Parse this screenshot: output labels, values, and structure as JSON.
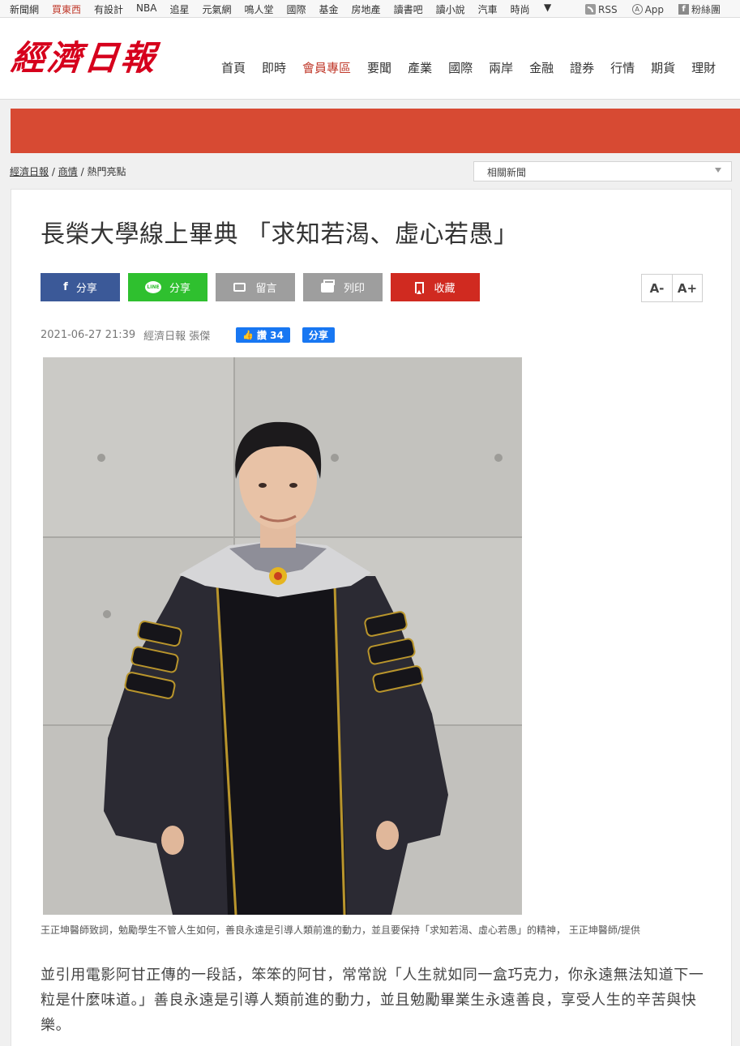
{
  "topbar": {
    "links": [
      "新聞網",
      "買東西",
      "有設計",
      "NBA",
      "追星",
      "元氣網",
      "鳴人堂",
      "國際",
      "基金",
      "房地產",
      "讀書吧",
      "讀小說",
      "汽車",
      "時尚"
    ],
    "more_icon": "triangle-down-icon",
    "rss_label": "RSS",
    "app_label": "App",
    "fans_label": "粉絲團"
  },
  "header": {
    "logo": "經濟日報",
    "nav": [
      "首頁",
      "即時",
      "會員專區",
      "要聞",
      "產業",
      "國際",
      "兩岸",
      "金融",
      "證券",
      "行情",
      "期貨",
      "理財"
    ]
  },
  "colors": {
    "brand": "#d6001c",
    "banner": "#d74a33",
    "facebook": "#3b5998",
    "line": "#2fc02f",
    "favorite": "#d02a20"
  },
  "breadcrumb": {
    "items": [
      "經濟日報",
      "商情",
      "熱門亮點"
    ],
    "separator": "/"
  },
  "related_select": {
    "value": "相關新聞"
  },
  "article": {
    "title": "長榮大學線上畢典 「求知若渴、虛心若愚」",
    "share_buttons": {
      "facebook": "分享",
      "line": "分享",
      "line_icon_text": "LINE",
      "comment": "留言",
      "print": "列印",
      "favorite": "收藏"
    },
    "font_size": {
      "decrease": "A-",
      "increase": "A+"
    },
    "date": "2021-06-27 21:39",
    "author": "經濟日報 張傑",
    "like_label": "讚 34",
    "fb_share_label": "分享",
    "caption": "王正坤醫師致詞，勉勵學生不管人生如何，善良永遠是引導人類前進的動力，並且要保持「求知若渴、虛心若愚」的精神， 王正坤醫師/提供",
    "body": "並引用電影阿甘正傳的一段話，笨笨的阿甘，常常說「人生就如同一盒巧克力，你永遠無法知道下一粒是什麼味道。」善良永遠是引導人類前進的動力，並且勉勵畢業生永遠善良，享受人生的辛苦與快樂。"
  }
}
